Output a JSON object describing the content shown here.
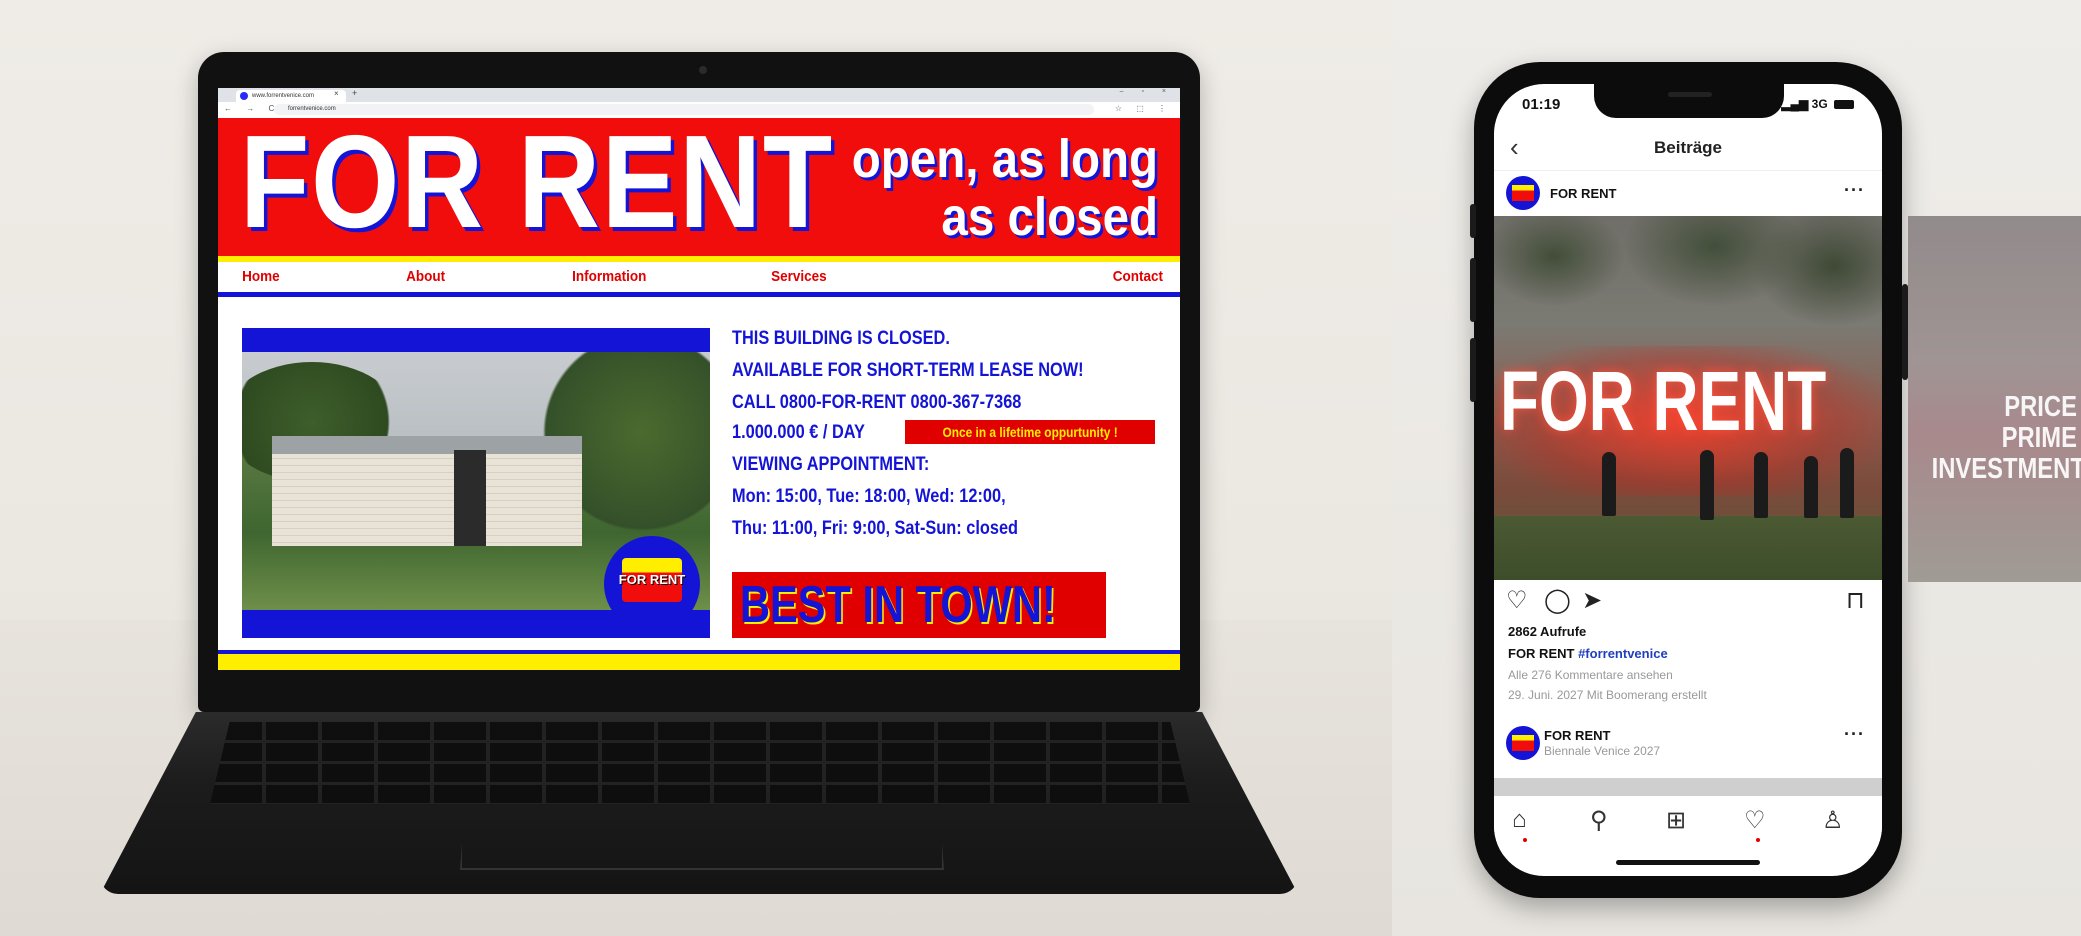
{
  "browser": {
    "tab_title": "www.forrentvenice.com",
    "url": "forrentvenice.com",
    "new_tab": "+",
    "tab_close": "×",
    "window_controls": "– ▫ ×",
    "nav_buttons": "← → C",
    "toolbar_icons": "☆ ⬚ ⋮"
  },
  "site": {
    "logo": "FOR RENT",
    "tagline_line1": "open, as long",
    "tagline_line2": "as closed",
    "nav": [
      "Home",
      "About",
      "Information",
      "Services",
      "Contact"
    ],
    "photo_badge": "FOR RENT",
    "info_lines": [
      "THIS BUILDING IS CLOSED.",
      "AVAILABLE FOR SHORT-TERM LEASE NOW!",
      "CALL 0800-FOR-RENT 0800-367-7368",
      "1.000.000 € / DAY",
      "VIEWING APPOINTMENT:",
      "Mon: 15:00, Tue: 18:00, Wed: 12:00,",
      "Thu: 11:00, Fri: 9:00, Sat-Sun: closed"
    ],
    "promo_badge": "Once in a lifetime oppurtunity !",
    "best_banner": "BEST IN TOWN!",
    "colors": {
      "red": "#f20d0d",
      "blue": "#1414d6",
      "yellow": "#ffee00"
    }
  },
  "phone": {
    "time": "01:19",
    "network": "3G",
    "header_title": "Beiträge",
    "post_user": "FOR RENT",
    "image_text": "FOR RENT",
    "views": "2862 Aufrufe",
    "caption_user": "FOR RENT",
    "caption_hashtag": "#forrentvenice",
    "comments_link": "Alle 276 Kommentare ansehen",
    "date": "29. Juni. 2027  Mit Boomerang erstellt",
    "post2_user": "FOR RENT",
    "post2_sub": "Biennale Venice 2027",
    "icons": [
      "back-icon",
      "heart-icon",
      "comment-icon",
      "share-icon",
      "bookmark-icon",
      "home-icon",
      "search-icon",
      "add-icon",
      "activity-icon",
      "profile-icon"
    ]
  },
  "billboard": {
    "line1": "PRICE RE",
    "line2": "PRIME LO",
    "line3": "INVESTMENT OI"
  }
}
